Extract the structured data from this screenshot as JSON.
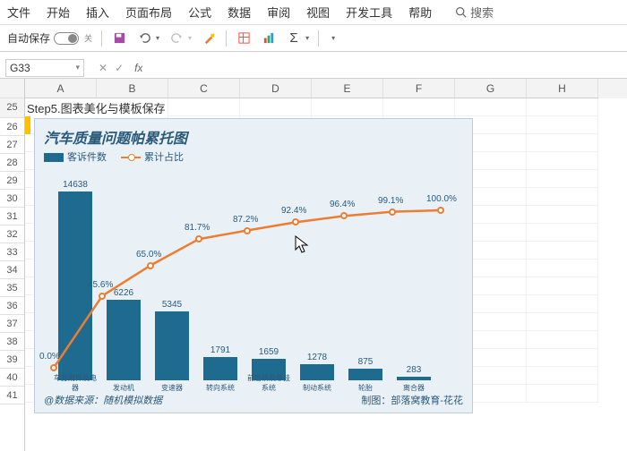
{
  "menu": {
    "items": [
      "文件",
      "开始",
      "插入",
      "页面布局",
      "公式",
      "数据",
      "审阅",
      "视图",
      "开发工具",
      "帮助"
    ],
    "search": "搜索"
  },
  "toolbar": {
    "autosave": "自动保存",
    "autosave_state": "关"
  },
  "namebox": {
    "ref": "G33"
  },
  "cols": [
    "A",
    "B",
    "C",
    "D",
    "E",
    "F",
    "G",
    "H"
  ],
  "rows": [
    "25",
    "26",
    "27",
    "28",
    "29",
    "30",
    "31",
    "32",
    "33",
    "34",
    "35",
    "36",
    "37",
    "38",
    "39",
    "40",
    "41"
  ],
  "step_text": "Step5.图表美化与模板保存",
  "chart": {
    "title": "汽车质量问题帕累托图",
    "legend_bar": "客诉件数",
    "legend_line": "累计占比",
    "footer_left": "@数据来源：随机模拟数据",
    "footer_right": "制图：部落窝教育-花花"
  },
  "chart_data": {
    "type": "pareto",
    "categories": [
      "车身附件及电器",
      "发动机",
      "变速器",
      "转向系统",
      "前后桥及悬挂系统",
      "制动系统",
      "轮胎",
      "离合器"
    ],
    "bar_values": [
      14638,
      6226,
      5345,
      1791,
      1659,
      1278,
      875,
      283
    ],
    "cum_pct": [
      0.0,
      45.6,
      65.0,
      81.7,
      87.2,
      92.4,
      96.4,
      99.1,
      100.0
    ],
    "bar_max": 15000,
    "xlabel": "",
    "ylabel": ""
  }
}
